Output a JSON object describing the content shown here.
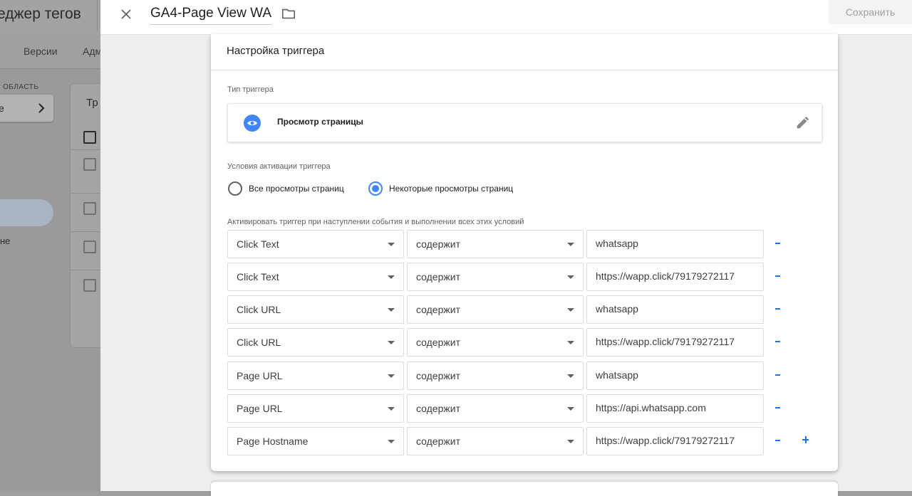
{
  "background": {
    "app_title": "еджер тегов",
    "tabs": [
      "Версии",
      "Адм"
    ],
    "workspace_label": "ОБЛАСТЬ",
    "workspace_value": "е",
    "side_text": "не",
    "card_title": "Тр"
  },
  "header": {
    "tag_name": "GA4-Page View WA",
    "save_label": "Сохранить"
  },
  "trigger": {
    "title": "Настройка триггера",
    "type_label": "Тип триггера",
    "type_name": "Просмотр страницы",
    "conditions_label": "Условия активации триггера",
    "options": [
      {
        "label": "Все просмотры страниц",
        "selected": false
      },
      {
        "label": "Некоторые просмотры страниц",
        "selected": true
      }
    ],
    "fire_label": "Активировать триггер при наступлении события и выполнении всех этих условий",
    "rows": [
      {
        "variable": "Click Text",
        "operator": "содержит",
        "value": "whatsapp"
      },
      {
        "variable": "Click Text",
        "operator": "содержит",
        "value": "https://wapp.click/79179272117"
      },
      {
        "variable": "Click URL",
        "operator": "содержит",
        "value": "whatsapp"
      },
      {
        "variable": "Click URL",
        "operator": "содержит",
        "value": "https://wapp.click/79179272117"
      },
      {
        "variable": "Page URL",
        "operator": "содержит",
        "value": "whatsapp"
      },
      {
        "variable": "Page URL",
        "operator": "содержит",
        "value": "https://api.whatsapp.com"
      },
      {
        "variable": "Page Hostname",
        "operator": "содержит",
        "value": "https://wapp.click/79179272117"
      }
    ]
  },
  "colors": {
    "accent": "#4285f4",
    "link": "#1a73e8",
    "overlay": "#9e9e9e"
  },
  "icons": [
    "close-icon",
    "folder-icon",
    "eye-icon",
    "pencil-icon",
    "chevron-right-icon",
    "caret-down-icon",
    "minus-icon",
    "plus-icon"
  ]
}
